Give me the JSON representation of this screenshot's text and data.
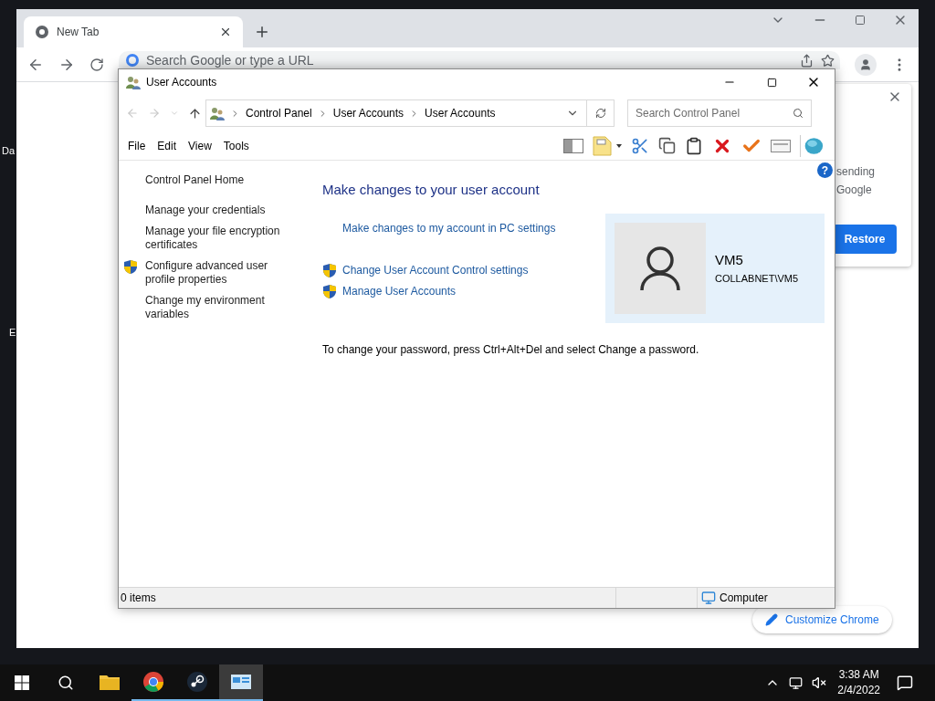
{
  "desktop": {
    "icon_labels": [
      "Da",
      "E"
    ]
  },
  "browser": {
    "tabs": [
      {
        "title": "New Tab",
        "selected": true
      }
    ],
    "omnibox": {
      "placeholder": "Search Google or type a URL"
    },
    "notification": {
      "lines": [
        "sending",
        "Google"
      ],
      "button": "Restore"
    },
    "customize_button": "Customize Chrome"
  },
  "window": {
    "title": "User Accounts",
    "breadcrumb": [
      "Control Panel",
      "User Accounts",
      "User Accounts"
    ],
    "search": {
      "placeholder": "Search Control Panel"
    },
    "menu": [
      "File",
      "Edit",
      "View",
      "Tools"
    ],
    "help": "?",
    "sidebar": {
      "items": [
        {
          "label": "Control Panel Home",
          "shield": false
        },
        {
          "label": "Manage your credentials",
          "shield": false
        },
        {
          "label": "Manage your file encryption certificates",
          "shield": false
        },
        {
          "label": "Configure advanced user profile properties",
          "shield": true
        },
        {
          "label": "Change my environment variables",
          "shield": false
        }
      ]
    },
    "heading": "Make changes to your user account",
    "pc_settings_link": "Make changes to my account in PC settings",
    "tasks": [
      {
        "label": "Change User Account Control settings",
        "shield": true
      },
      {
        "label": "Manage User Accounts",
        "shield": true
      }
    ],
    "account": {
      "name": "VM5",
      "domain": "COLLABNET\\VM5"
    },
    "note": "To change your password, press Ctrl+Alt+Del and select Change a password.",
    "status_bar": {
      "items": "0 items",
      "zone": "Computer"
    }
  },
  "taskbar": {
    "apps": [
      {
        "kind": "explorer",
        "running": false,
        "selected": false
      },
      {
        "kind": "chrome",
        "running": true,
        "selected": false
      },
      {
        "kind": "steam",
        "running": true,
        "selected": false
      },
      {
        "kind": "control-panel",
        "running": true,
        "selected": true
      }
    ],
    "time": "3:38 AM",
    "date": "2/4/2022"
  }
}
